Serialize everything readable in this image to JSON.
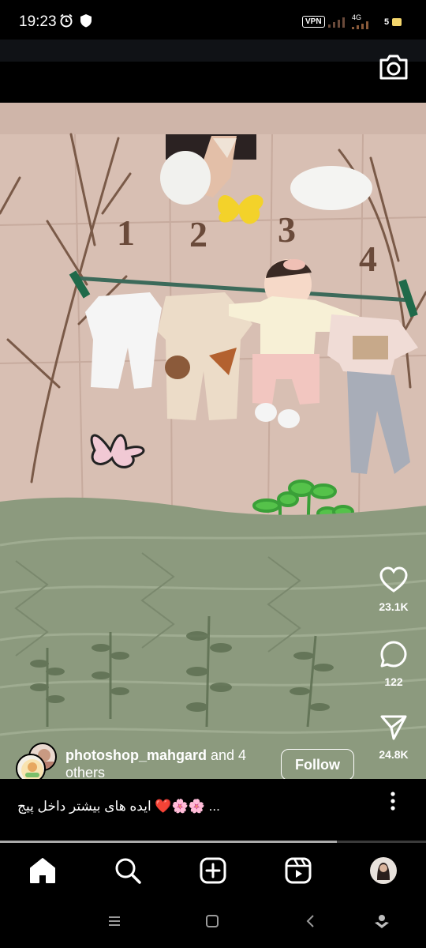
{
  "status_bar": {
    "time": "19:23",
    "vpn": "VPN",
    "network": "4G",
    "battery": "5"
  },
  "reel": {
    "numbers": [
      "1",
      "2",
      "3",
      "4"
    ],
    "likes": "23.1K",
    "comments": "122",
    "shares": "24.8K",
    "author": "photoshop_mahgard",
    "coauthors": "and 4 others",
    "follow_label": "Follow",
    "caption": "ایده های بیشتر داخل پیج ❤️🌸🌸 ...",
    "progress": 0.79
  },
  "icons": {
    "status": [
      "alarm-icon",
      "shield-icon",
      "signal-icon",
      "battery-icon"
    ],
    "top": "camera-icon",
    "actions": [
      "heart-icon",
      "comment-icon",
      "send-icon",
      "more-icon"
    ],
    "nav": [
      "home-icon",
      "search-icon",
      "create-icon",
      "reels-icon",
      "profile-avatar"
    ],
    "system": [
      "recents-icon",
      "home-square-icon",
      "back-icon",
      "assistant-icon"
    ]
  },
  "colors": {
    "background": "#000000",
    "mat": "#d8bfb3",
    "blanket": "#8c9a7e",
    "text": "#ffffff"
  }
}
